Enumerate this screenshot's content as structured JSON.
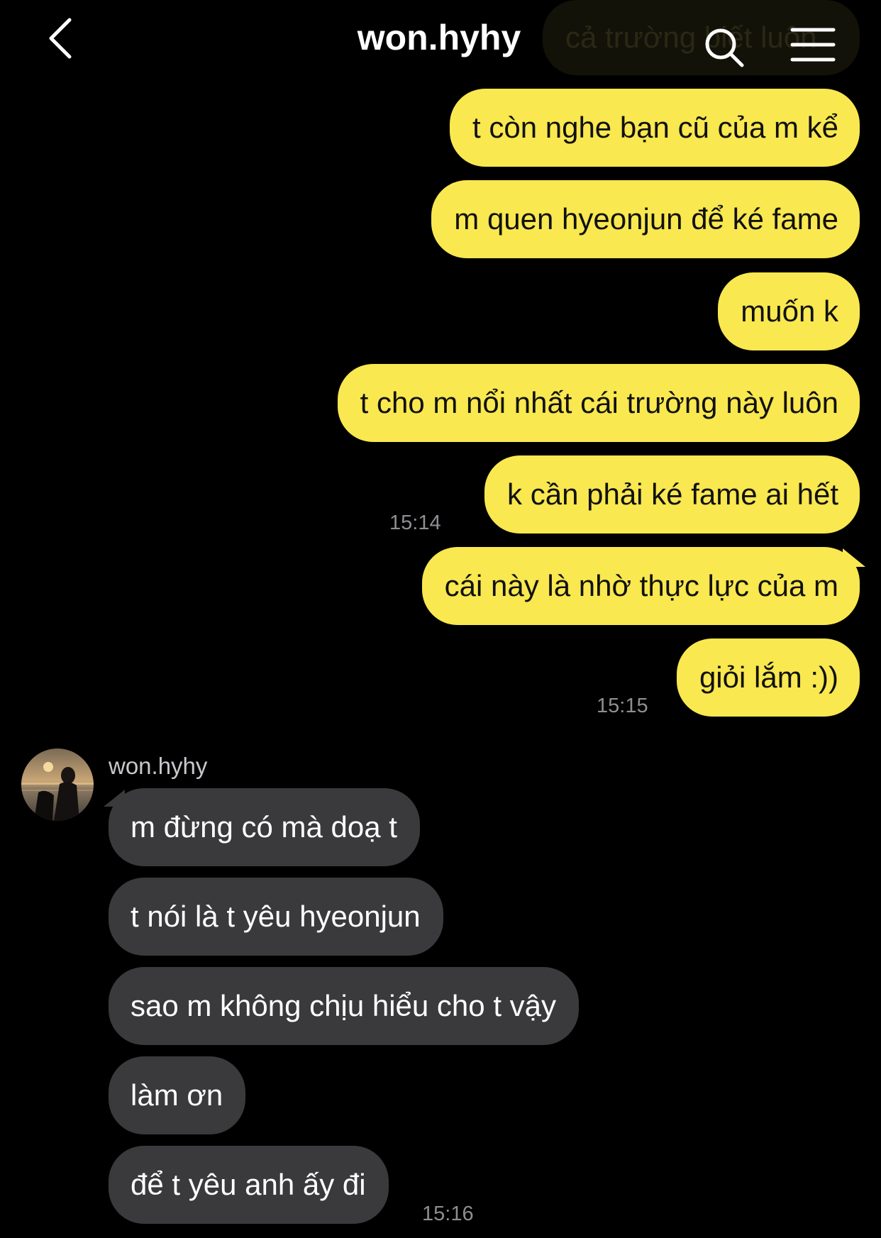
{
  "header": {
    "title": "won.hyhy",
    "ghost_message": "cả trường biết luôn",
    "back_icon": "chevron-left-icon",
    "search_icon": "search-icon",
    "menu_icon": "menu-icon"
  },
  "colors": {
    "background": "#000000",
    "sent_bubble": "#F9E84F",
    "received_bubble": "#3A3A3C",
    "timestamp": "#8E8E93"
  },
  "sent_messages": [
    {
      "text": "t còn nghe bạn cũ của m kể"
    },
    {
      "text": "m quen hyeonjun để ké fame"
    },
    {
      "text": "muốn k"
    },
    {
      "text": "t cho m nổi nhất cái trường này luôn"
    },
    {
      "text": "k cần phải ké fame ai hết",
      "time": "15:14"
    },
    {
      "text": "cái này là nhờ thực lực của m"
    },
    {
      "text": "giỏi lắm :))",
      "time": "15:15"
    }
  ],
  "received": {
    "sender": "won.hyhy",
    "messages": [
      {
        "text": "m đừng có mà doạ t"
      },
      {
        "text": "t nói là t yêu hyeonjun"
      },
      {
        "text": "sao m không chịu hiểu cho t vậy"
      },
      {
        "text": "làm ơn"
      },
      {
        "text": "để t yêu anh ấy đi",
        "time": "15:16"
      }
    ]
  }
}
